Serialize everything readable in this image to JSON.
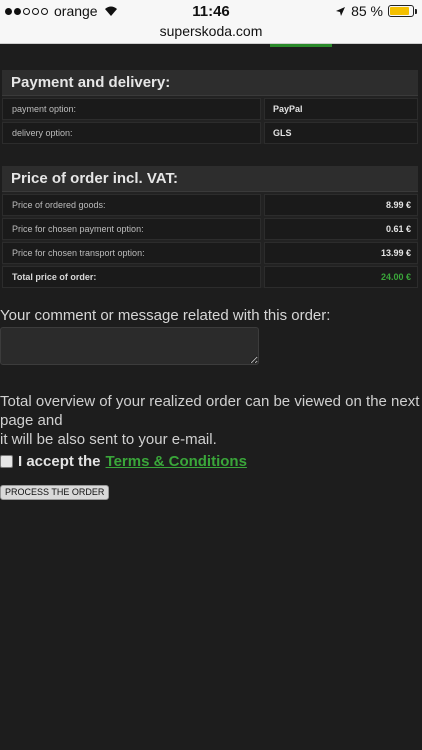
{
  "status_bar": {
    "carrier": "orange",
    "time": "11:46",
    "battery": "85 %",
    "battery_level": 0.85
  },
  "browser": {
    "url": "superskoda.com"
  },
  "payment_panel": {
    "title": "Payment and delivery:",
    "rows": [
      {
        "label": "payment option:",
        "value": "PayPal"
      },
      {
        "label": "delivery option:",
        "value": "GLS"
      }
    ]
  },
  "price_panel": {
    "title": "Price of order incl. VAT:",
    "rows": [
      {
        "label": "Price of ordered goods:",
        "value": "8.99 €"
      },
      {
        "label": "Price for chosen payment option:",
        "value": "0.61 €"
      },
      {
        "label": "Price for chosen transport option:",
        "value": "13.99 €"
      },
      {
        "label": "Total price of order:",
        "value": "24.00 €"
      }
    ]
  },
  "comment": {
    "label": "Your comment or message related with this order:",
    "value": ""
  },
  "overview": {
    "line1": "Total overview of your realized order can be viewed on the next page and",
    "line2": "it will be also sent to your e-mail."
  },
  "terms": {
    "prefix": "I accept the",
    "link": "Terms & Conditions",
    "checked": false
  },
  "process_button": "PROCESS THE ORDER",
  "colors": {
    "background": "#1d1d1d",
    "accent_green": "#3aa63a"
  }
}
